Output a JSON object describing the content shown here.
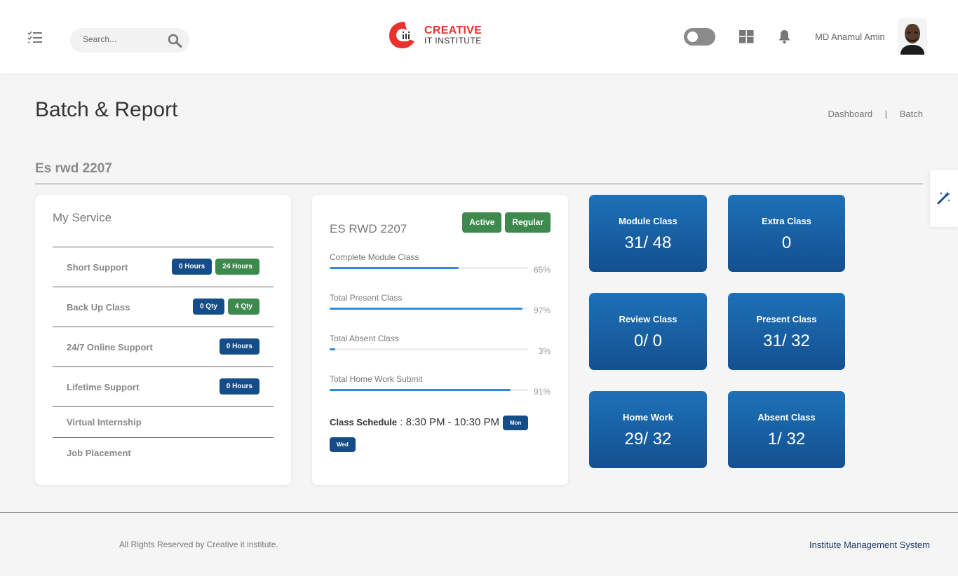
{
  "header": {
    "search_placeholder": "Search...",
    "brand_main": "CREATIVE",
    "brand_sub": "IT INSTITUTE",
    "user_name": "MD Anamul Amin"
  },
  "page": {
    "title": "Batch & Report",
    "breadcrumb": [
      "Dashboard",
      "Batch"
    ],
    "batch_name": "Es rwd 2207"
  },
  "service": {
    "title": "My Service",
    "items": [
      {
        "label": "Short Support",
        "badges": [
          {
            "text": "0 Hours",
            "color": "blue"
          },
          {
            "text": "24 Hours",
            "color": "green"
          }
        ]
      },
      {
        "label": "Back Up Class",
        "badges": [
          {
            "text": "0 Qty",
            "color": "blue"
          },
          {
            "text": "4 Qty",
            "color": "green"
          }
        ]
      },
      {
        "label": "24/7 Online Support",
        "badges": [
          {
            "text": "0 Hours",
            "color": "blue"
          }
        ]
      },
      {
        "label": "Lifetime Support",
        "badges": [
          {
            "text": "0 Hours",
            "color": "blue"
          }
        ]
      },
      {
        "label": "Virtual Internship",
        "badges": []
      },
      {
        "label": "Job Placement",
        "badges": []
      }
    ]
  },
  "batch": {
    "title": "ES RWD 2207",
    "status": [
      "Active",
      "Regular"
    ],
    "progress": [
      {
        "label": "Complete Module Class",
        "percent": 65,
        "text": "65%"
      },
      {
        "label": "Total Present Class",
        "percent": 97,
        "text": "97%"
      },
      {
        "label": "Total Absent Class",
        "percent": 3,
        "text": "3%"
      },
      {
        "label": "Total Home Work Submit",
        "percent": 91,
        "text": "91%"
      }
    ],
    "schedule_label": "Class Schedule",
    "schedule_time": " : 8:30 PM - 10:30 PM",
    "days": [
      "Mon",
      "Wed"
    ]
  },
  "stats": [
    {
      "label": "Module Class",
      "value": "31/ 48"
    },
    {
      "label": "Extra Class",
      "value": "0"
    },
    {
      "label": "Review Class",
      "value": "0/ 0"
    },
    {
      "label": "Present Class",
      "value": "31/ 32"
    },
    {
      "label": "Home Work",
      "value": "29/ 32"
    },
    {
      "label": "Absent Class",
      "value": "1/ 32"
    }
  ],
  "footer": {
    "left": "All Rights Reserved by Creative it institute.",
    "right": "Institute Management System"
  },
  "colors": {
    "primary": "#144d87",
    "success": "#3e8a4e",
    "brand_red": "#e8322e",
    "progress": "#2f8adb"
  }
}
